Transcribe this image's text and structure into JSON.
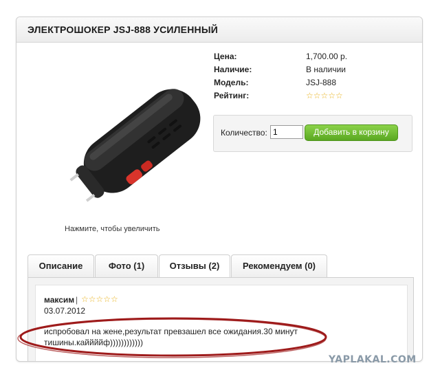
{
  "product": {
    "title": "ЭЛЕКТРОШОКЕР JSJ-888 УСИЛЕННЫЙ",
    "image_caption": "Нажмите, чтобы увеличить",
    "image_icon": "stun-gun-photo",
    "info": {
      "price_label": "Цена:",
      "price_value": "1,700.00 р.",
      "availability_label": "Наличие:",
      "availability_value": "В наличии",
      "model_label": "Модель:",
      "model_value": "JSJ-888",
      "rating_label": "Рейтинг:",
      "rating_stars": "☆☆☆☆☆"
    },
    "cart": {
      "quantity_label": "Количество:",
      "quantity_value": "1",
      "add_button_label": "Добавить в корзину"
    }
  },
  "tabs": [
    {
      "label": "Описание"
    },
    {
      "label": "Фото (1)"
    },
    {
      "label": "Отзывы (2)"
    },
    {
      "label": "Рекомендуем (0)"
    }
  ],
  "active_tab": "Отзывы (2)",
  "review": {
    "author": "максим",
    "separator": "|",
    "stars": "☆☆☆☆☆",
    "date": "03.07.2012",
    "text": "испробовал на жене,результат превзашел все ожидания.30 минут тишины.каййййф))))))))))))"
  },
  "watermark": "YAPLAKAL.COM",
  "colors": {
    "accent_green": "#6abb2e",
    "star_gold": "#e8b11a",
    "highlight_red": "#9e1b1b"
  }
}
